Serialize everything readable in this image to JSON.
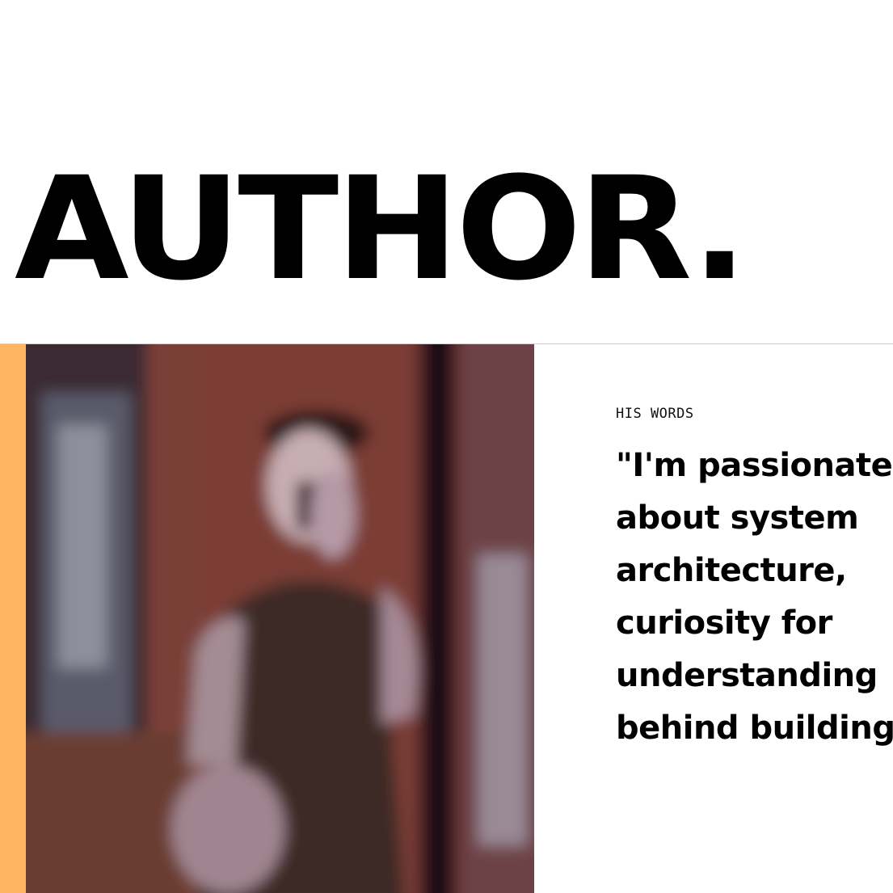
{
  "hero": {
    "title": "AUTHOR."
  },
  "about": {
    "label": "HIS WORDS",
    "quote": "\"I'm passionate about system architecture, curiosity for understanding behind building applications, and systems.\""
  },
  "photo": {
    "description_icon": "person-photo"
  },
  "colors": {
    "accent": "#ffb561",
    "text": "#000000",
    "background": "#ffffff"
  }
}
